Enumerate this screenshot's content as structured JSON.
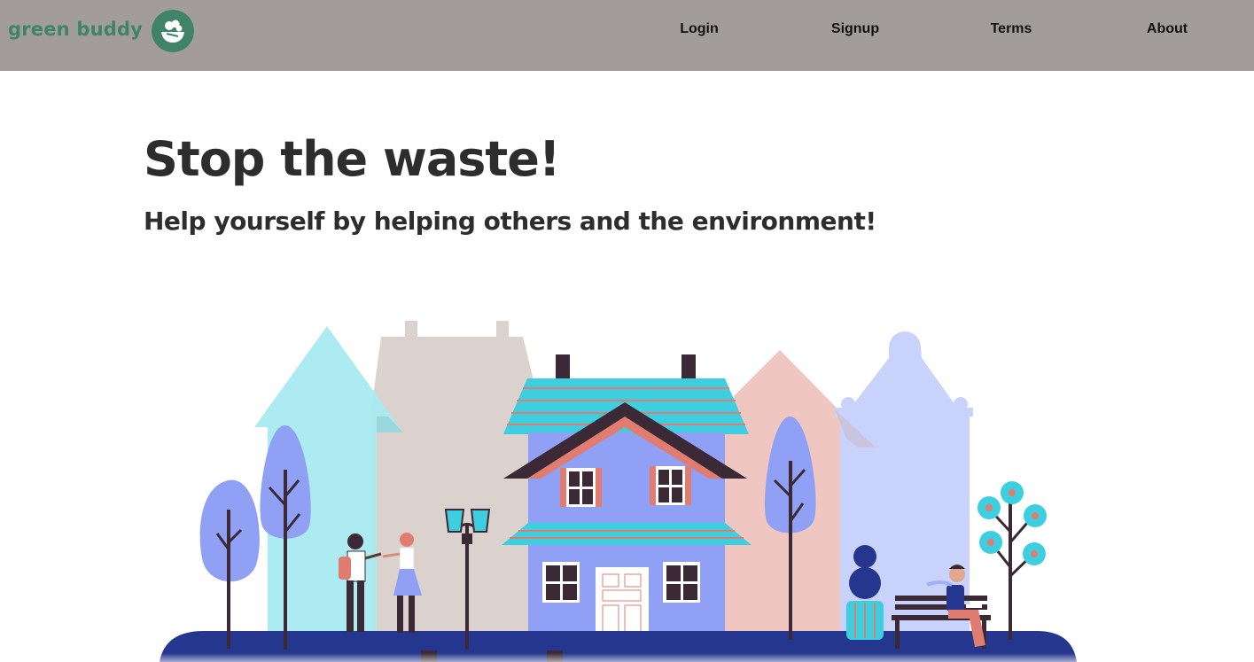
{
  "brand": {
    "name": "green buddy",
    "color": "#3f8468",
    "logo_icon": "salad-bowl-icon"
  },
  "nav": {
    "background": "#a29d9c",
    "links": [
      {
        "label": "Login"
      },
      {
        "label": "Signup"
      },
      {
        "label": "Terms"
      },
      {
        "label": "About"
      }
    ]
  },
  "hero": {
    "title": "Stop the waste!",
    "subtitle": "Help yourself by helping others and the environment!"
  },
  "illustration": {
    "icon": "town-street-illustration",
    "colors": {
      "ground": "#25368f",
      "house": "#8fa0f5",
      "roof_teal": "#3dcfe0",
      "building_cyan": "#a8eaf0",
      "building_beige": "#dcd2cd",
      "building_pink": "#efc7c0",
      "building_lavender": "#c8d2fb"
    }
  }
}
